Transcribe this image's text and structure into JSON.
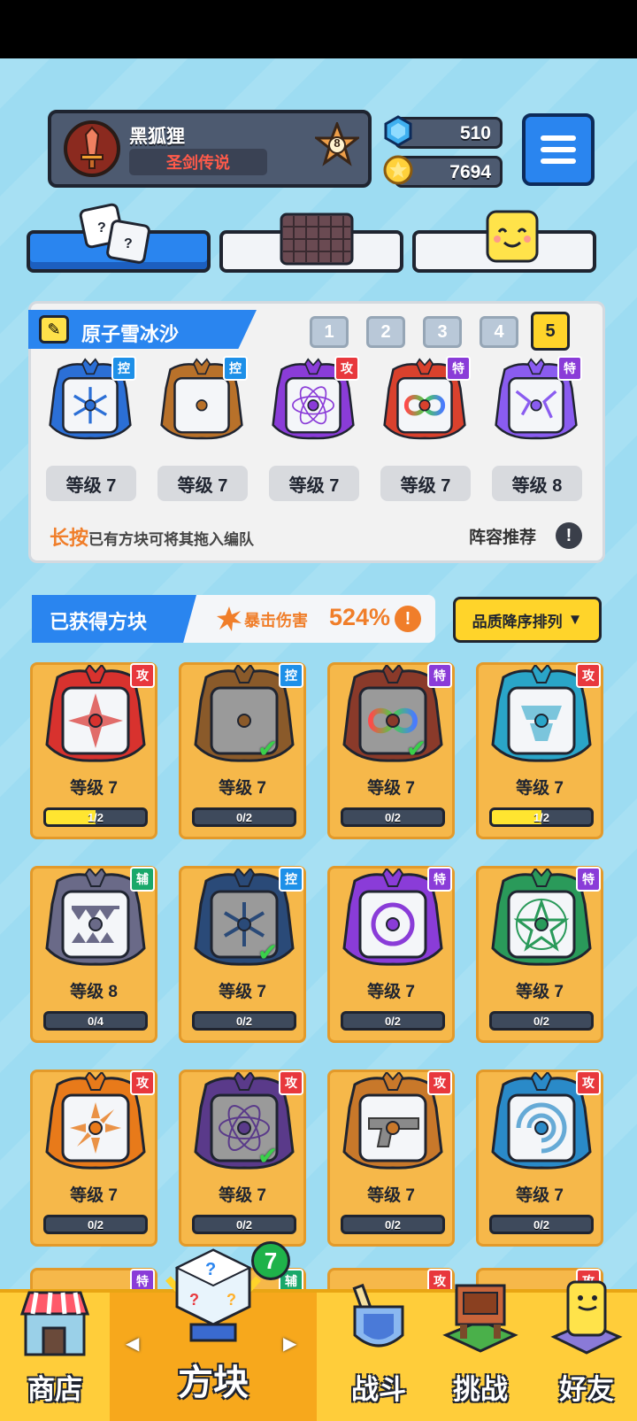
{
  "player": {
    "name": "黑狐狸",
    "title": "圣剑传说",
    "rank": "8"
  },
  "currency": {
    "gems": "510",
    "gold": "7694"
  },
  "top_tabs": [
    {
      "icon": "dice-icon",
      "active": true
    },
    {
      "icon": "grid-board-icon",
      "active": false
    },
    {
      "icon": "smiley-cube-icon",
      "active": false
    }
  ],
  "deck": {
    "name": "原子雪冰沙",
    "slots": [
      "1",
      "2",
      "3",
      "4",
      "5"
    ],
    "active_slot": "5",
    "cubes": [
      {
        "tag": "控",
        "type": "ctl",
        "level": "等级 7",
        "art": "snowflake",
        "color": "#2b6fd6"
      },
      {
        "tag": "控",
        "type": "ctl",
        "level": "等级 7",
        "art": "plain",
        "color": "#b8712a"
      },
      {
        "tag": "攻",
        "type": "atk",
        "level": "等级 7",
        "art": "atom",
        "color": "#8a3cd8"
      },
      {
        "tag": "特",
        "type": "spc",
        "level": "等级 7",
        "art": "infinity",
        "color": "#d9412d"
      },
      {
        "tag": "特",
        "type": "spc",
        "level": "等级 8",
        "art": "crack",
        "color": "#8a5cf0"
      }
    ],
    "hint_emphasis": "长按",
    "hint_text": "已有方块可将其拖入编队",
    "recommend_label": "阵容推荐"
  },
  "owned": {
    "title": "已获得方块",
    "crit_label": "暴击伤害",
    "crit_value": "524%",
    "sort_label": "品质降序排列"
  },
  "cards": [
    {
      "tag": "攻",
      "type": "atk",
      "level": "等级 7",
      "progress": "1/2",
      "fill": 0.5,
      "color": "#d8322e",
      "art": "compass",
      "check": false
    },
    {
      "tag": "控",
      "type": "ctl",
      "level": "等级 7",
      "progress": "0/2",
      "fill": 0,
      "color": "#8a5a2a",
      "art": "plain",
      "check": true
    },
    {
      "tag": "特",
      "type": "spc",
      "level": "等级 7",
      "progress": "0/2",
      "fill": 0,
      "color": "#8a3a2a",
      "art": "infinity",
      "check": true
    },
    {
      "tag": "攻",
      "type": "atk",
      "level": "等级 7",
      "progress": "1/2",
      "fill": 0.5,
      "color": "#2aa5c8",
      "art": "totem",
      "check": false
    },
    {
      "tag": "辅",
      "type": "sup",
      "level": "等级 8",
      "progress": "0/4",
      "fill": 0,
      "color": "#6a6a88",
      "art": "jaws",
      "check": false
    },
    {
      "tag": "控",
      "type": "ctl",
      "level": "等级 7",
      "progress": "0/2",
      "fill": 0,
      "color": "#2a4a78",
      "art": "snowflake",
      "check": true
    },
    {
      "tag": "特",
      "type": "spc",
      "level": "等级 7",
      "progress": "0/2",
      "fill": 0,
      "color": "#8a3cd8",
      "art": "ring",
      "check": false
    },
    {
      "tag": "特",
      "type": "spc",
      "level": "等级 7",
      "progress": "0/2",
      "fill": 0,
      "color": "#2a9a5a",
      "art": "pentagram",
      "check": false
    },
    {
      "tag": "攻",
      "type": "atk",
      "level": "等级 7",
      "progress": "0/2",
      "fill": 0,
      "color": "#e87a1a",
      "art": "sun",
      "check": false
    },
    {
      "tag": "攻",
      "type": "atk",
      "level": "等级 7",
      "progress": "0/2",
      "fill": 0,
      "color": "#5a3a8a",
      "art": "atom",
      "check": true
    },
    {
      "tag": "攻",
      "type": "atk",
      "level": "等级 7",
      "progress": "0/2",
      "fill": 0,
      "color": "#c8782a",
      "art": "gun",
      "check": false
    },
    {
      "tag": "攻",
      "type": "atk",
      "level": "等级 7",
      "progress": "0/2",
      "fill": 0,
      "color": "#2a8ac8",
      "art": "swirl",
      "check": false
    }
  ],
  "next_row_tags": [
    {
      "tag": "特",
      "type": "spc"
    },
    {
      "tag": "辅",
      "type": "sup"
    },
    {
      "tag": "攻",
      "type": "atk"
    },
    {
      "tag": "攻",
      "type": "atk"
    }
  ],
  "nav": {
    "shop": "商店",
    "cubes": "方块",
    "battle": "战斗",
    "challenge": "挑战",
    "friends": "好友",
    "cubes_badge": "7"
  },
  "colors": {
    "accent_blue": "#2a85ef",
    "gold_yellow": "#ffd42a",
    "card_orange": "#f6b84a",
    "orange_text": "#f07e2a"
  }
}
